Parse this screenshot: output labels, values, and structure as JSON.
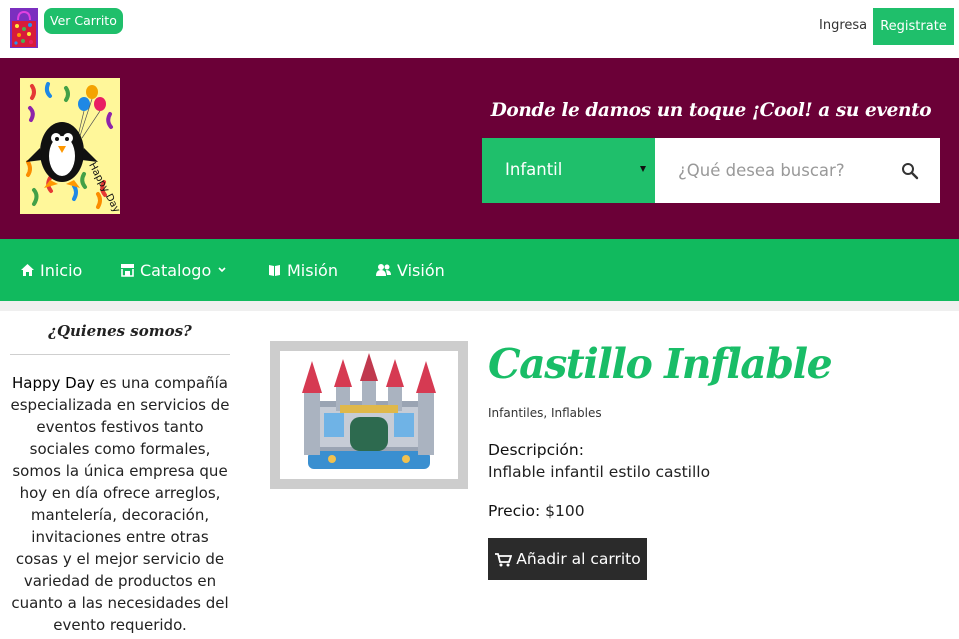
{
  "topbar": {
    "cart_button_label": "Ver Carrito",
    "login_label": "Ingresa",
    "register_label": "Registrate"
  },
  "header": {
    "logo_text": "Happy Day",
    "slogan": "Donde le damos un toque ¡Cool! a su evento",
    "category_selected": "Infantil",
    "search_placeholder": "¿Qué desea buscar?"
  },
  "nav": {
    "items": [
      {
        "label": "Inicio",
        "icon": "home-icon"
      },
      {
        "label": "Catalogo",
        "icon": "store-icon"
      },
      {
        "label": "Misión",
        "icon": "book-icon"
      },
      {
        "label": "Visión",
        "icon": "users-icon"
      }
    ]
  },
  "sidebar": {
    "title": "¿Quienes somos?",
    "company_name": "Happy Day",
    "about_text": "es una compañía especializada en servicios de eventos festivos tanto sociales como formales, somos la única empresa que hoy en día ofrece arreglos, mantelería, decoración, invitaciones entre otras cosas y el mejor servicio de variedad de productos en cuanto a las necesidades del evento requerido."
  },
  "product": {
    "title": "Castillo Inflable",
    "categories": "Infantiles, Inflables",
    "description_label": "Descripción:",
    "description": "Inflable infantil estilo castillo",
    "price_label": "Precio:",
    "price": "$100",
    "add_to_cart_label": "Añadir al carrito"
  },
  "colors": {
    "brand_green": "#1fbf6b",
    "header_maroon": "#6b0037",
    "button_dark": "#2b2b2b"
  }
}
